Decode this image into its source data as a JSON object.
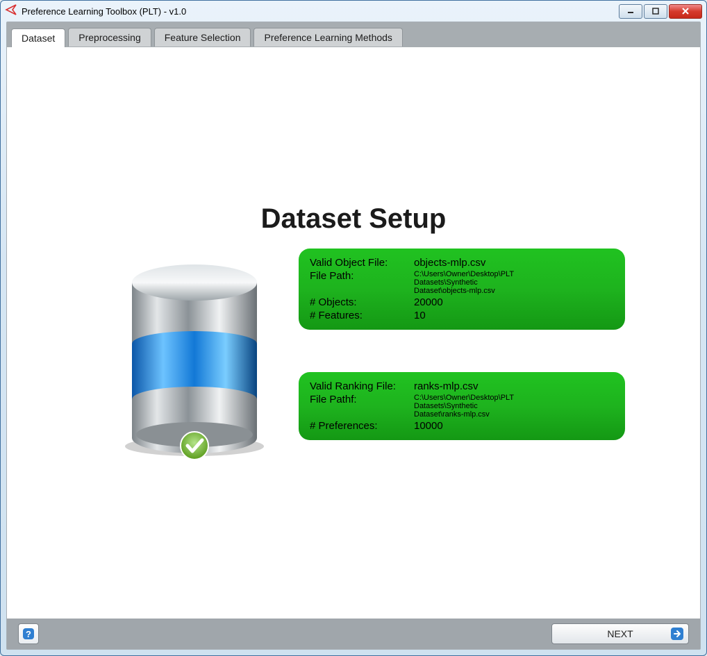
{
  "window": {
    "title": "Preference Learning Toolbox (PLT) - v1.0"
  },
  "tabs": [
    {
      "label": "Dataset"
    },
    {
      "label": "Preprocessing"
    },
    {
      "label": "Feature Selection"
    },
    {
      "label": "Preference Learning Methods"
    }
  ],
  "page": {
    "heading": "Dataset Setup"
  },
  "object_panel": {
    "file_label": "Valid Object File:",
    "file_value": "objects-mlp.csv",
    "path_label": "File Path:",
    "path_value": "C:\\Users\\Owner\\Desktop\\PLT Datasets\\Synthetic Dataset\\objects-mlp.csv",
    "objects_label": "# Objects:",
    "objects_value": "20000",
    "features_label": "# Features:",
    "features_value": "10"
  },
  "ranking_panel": {
    "file_label": "Valid Ranking File:",
    "file_value": "ranks-mlp.csv",
    "path_label": "File Pathf:",
    "path_value": "C:\\Users\\Owner\\Desktop\\PLT Datasets\\Synthetic Dataset\\ranks-mlp.csv",
    "prefs_label": "# Preferences:",
    "prefs_value": "10000"
  },
  "footer": {
    "next_label": "NEXT"
  }
}
